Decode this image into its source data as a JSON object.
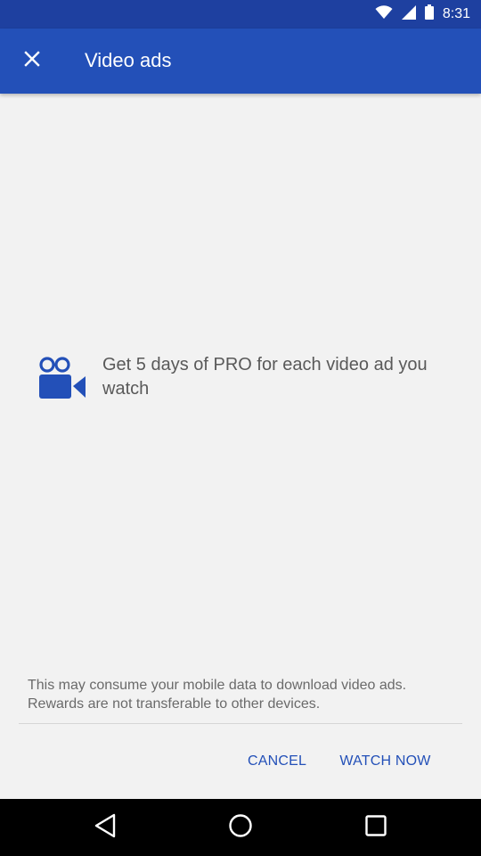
{
  "status_bar": {
    "time": "8:31",
    "icons": [
      "wifi-icon",
      "signal-icon",
      "battery-icon"
    ]
  },
  "app_bar": {
    "title": "Video ads",
    "close_icon": "close-icon"
  },
  "promo": {
    "icon": "video-camera-icon",
    "text": "Get 5 days of PRO for each video ad you watch"
  },
  "notice": {
    "text": "This may consume your mobile data to download video ads. Rewards are not transferable to other devices."
  },
  "actions": {
    "cancel_label": "CANCEL",
    "watch_now_label": "WATCH NOW"
  },
  "nav_bar": {
    "icons": [
      "back-icon",
      "home-icon",
      "recents-icon"
    ]
  },
  "colors": {
    "primary": "#2350b8",
    "status_bar": "#1e40a0",
    "background": "#f2f2f2",
    "text_secondary": "#595959"
  }
}
